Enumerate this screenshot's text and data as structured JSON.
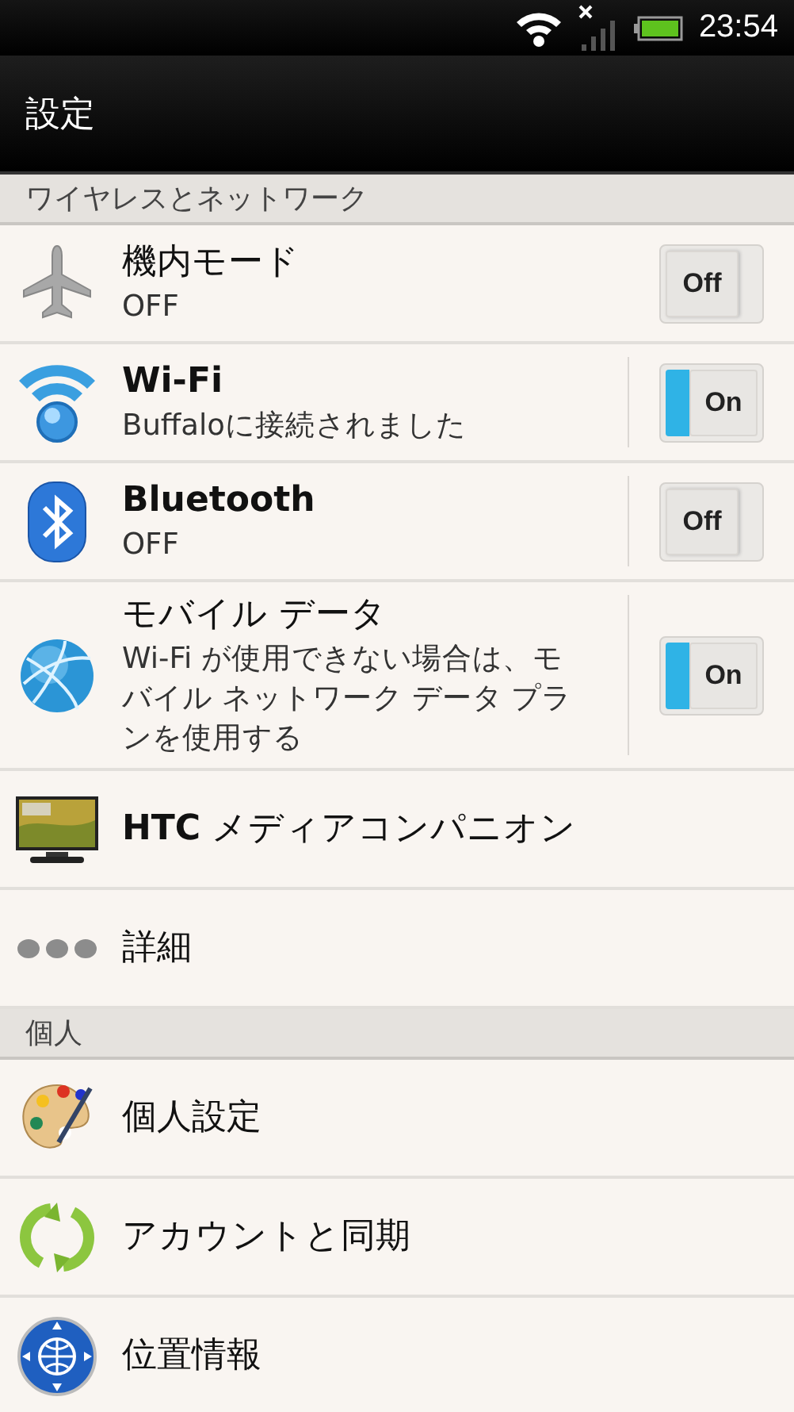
{
  "status_bar": {
    "time": "23:54"
  },
  "title": "設定",
  "sections": [
    {
      "header": "ワイヤレスとネットワーク",
      "items": [
        {
          "kind": "toggle",
          "title": "機内モード",
          "bold": false,
          "subtitle": "OFF",
          "on": false,
          "switch_label": "Off",
          "separated": false
        },
        {
          "kind": "toggle",
          "title": "Wi-Fi",
          "bold": true,
          "subtitle": "Buffaloに接続されました",
          "on": true,
          "switch_label": "On",
          "separated": true
        },
        {
          "kind": "toggle",
          "title": "Bluetooth",
          "bold": true,
          "subtitle": "OFF",
          "on": false,
          "switch_label": "Off",
          "separated": true
        },
        {
          "kind": "toggle",
          "title": "モバイル データ",
          "bold": false,
          "subtitle": "Wi-Fi が使用できない場合は、モバイル ネットワーク データ プランを使用する",
          "on": true,
          "switch_label": "On",
          "separated": true
        },
        {
          "kind": "plain",
          "title": "**HTC** メディアコンパニオン",
          "bold": false
        },
        {
          "kind": "plain",
          "title": "詳細",
          "bold": false
        }
      ]
    },
    {
      "header": "個人",
      "items": [
        {
          "kind": "plain",
          "title": "個人設定",
          "bold": false
        },
        {
          "kind": "plain",
          "title": "アカウントと同期",
          "bold": false
        },
        {
          "kind": "plain",
          "title": "位置情報",
          "bold": false
        }
      ]
    }
  ]
}
